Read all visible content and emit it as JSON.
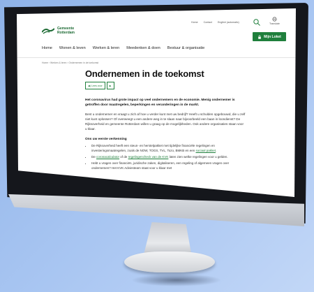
{
  "header": {
    "logo_line1": "Gemeente",
    "logo_line2": "Rotterdam",
    "util_links": [
      "Home",
      "Contact",
      "English (automatic)"
    ],
    "translate_label": "Translate",
    "mijn_loket": "Mijn Loket"
  },
  "nav": [
    "Home",
    "Wonen & leven",
    "Werken & leren",
    "Meedenken & doen",
    "Bestuur & organisatie"
  ],
  "breadcrumb": "Home › Werken & leren › Ondernemen in de toekomst",
  "page": {
    "title": "Ondernemen in de toekomst",
    "readspeaker_label": "Lees voor",
    "lead": "Het coronavirus had grote impact op veel ondernemers en de economie. Menig ondernemer is getroffen door maatregelen, beperkingen en veranderingen in de markt.",
    "para": "Bent u ondernemer en vraagt u zich af hoe u verder kunt met uw bedrijf? Heeft u schulden opgebouwd, die u zelf niet kunt oplossen? Of overweegt u een andere weg in te slaan naar bijvoorbeeld een baan in loondienst? De Rijksoverheid en gemeente Rotterdam willen u graag op de mogelijkheden. Ook andere organisaties staan voor u klaar.",
    "subhead": "Ons uw eerste verkenning",
    "bullet1_a": "De Rijksoverheid heeft een steun- en herstelpakket met tijdelijke financiële regelingen en investeringsmaatregelen, zoals de NOW, TOGS, TVL, Tozo, BMKB en een ",
    "bullet1_link": "sociaal pakket",
    "bullet2_a": "De ",
    "bullet2_link1": "coronacalculator",
    "bullet2_b": " of de ",
    "bullet2_link2": "regelingencheck van de KVK",
    "bullet2_c": " laten zien welke regelingen voor u gelden.",
    "bullet3": "Hebt u vragen over financiën, juridische zaken, digitaliseren, een regeling of algemeen vragen over ondernemen? Het KVK Adviesteam staat voor u klaar met"
  },
  "colors": {
    "brand_green": "#1f7f3c",
    "background": "#a9c6f2"
  }
}
